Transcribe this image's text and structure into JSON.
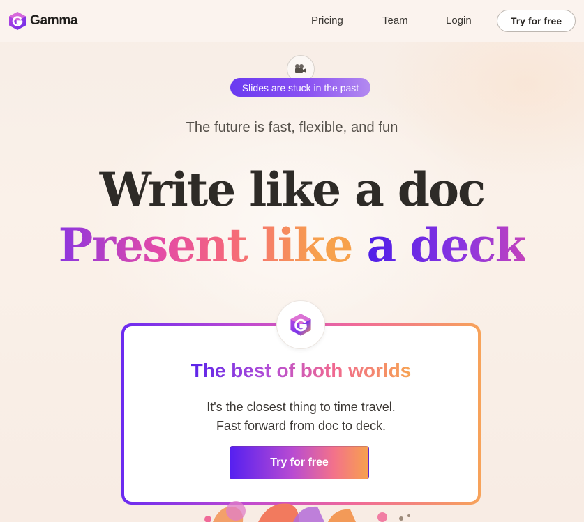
{
  "header": {
    "brand": "Gamma",
    "nav": [
      {
        "label": "Pricing"
      },
      {
        "label": "Team"
      },
      {
        "label": "Login"
      }
    ],
    "cta_label": "Try for free"
  },
  "hero": {
    "icon": "video-camera-icon",
    "pill_label": "Slides are stuck in the past",
    "tagline": "The future is fast, flexible, and fun",
    "headline_line1": "Write like a doc",
    "headline_line2": "Present like a deck"
  },
  "card": {
    "icon": "gamma-logo-icon",
    "title": "The best of both worlds",
    "line1": "It's the closest thing to time travel.",
    "line2": "Fast forward from doc to deck.",
    "cta_label": "Try for free"
  },
  "colors": {
    "accent_purple": "#6a3af0",
    "accent_pink": "#f06890",
    "accent_orange": "#f7a352",
    "background": "#f7ede6"
  }
}
